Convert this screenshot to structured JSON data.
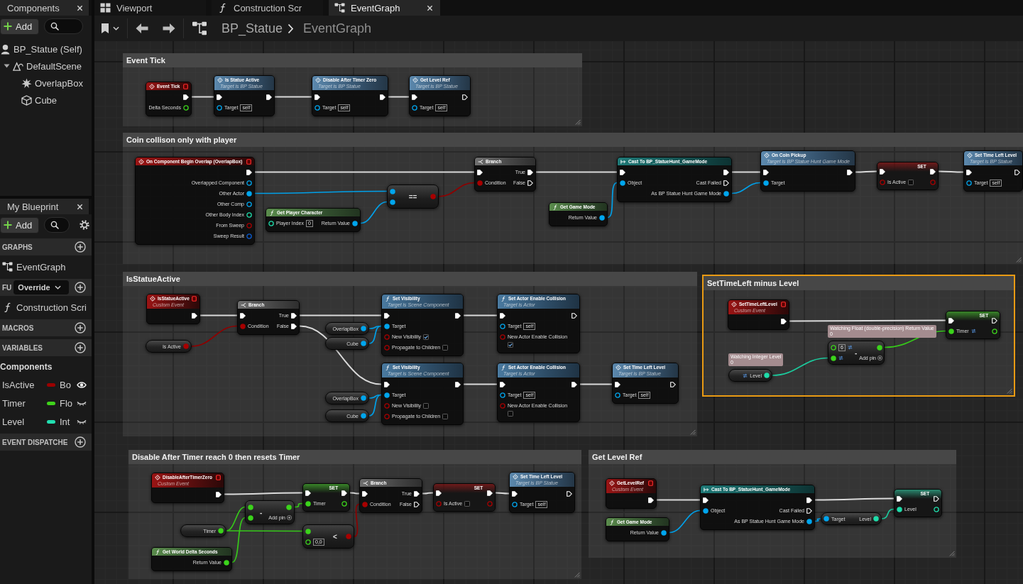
{
  "components_panel": {
    "tab": "Components",
    "add_button": "Add",
    "tree": [
      {
        "label": "BP_Statue (Self)",
        "kind": "actor"
      },
      {
        "label": "DefaultScene",
        "kind": "scene",
        "expanded": true,
        "children": [
          {
            "label": "OverlapBox",
            "kind": "collision"
          },
          {
            "label": "Cube",
            "kind": "mesh"
          }
        ]
      }
    ]
  },
  "my_blueprint_panel": {
    "tab": "My Blueprint",
    "add_button": "Add",
    "sections": [
      {
        "title": "GRAPHS",
        "items": [
          {
            "kind": "graph",
            "label": "EventGraph"
          }
        ]
      },
      {
        "title": "FU",
        "dropdown": "Override",
        "items": [
          {
            "kind": "function",
            "label": "Construction Scri"
          }
        ]
      },
      {
        "title": "MACROS"
      },
      {
        "title": "VARIABLES",
        "items": [
          {
            "kind": "category",
            "label": "Components"
          },
          {
            "kind": "variable",
            "label": "IsActive",
            "type_label": "Bo",
            "color": "#9b0000",
            "visible": true
          },
          {
            "kind": "variable",
            "label": "Timer",
            "type_label": "Flo",
            "color": "#3fd21b",
            "visible": false
          },
          {
            "kind": "variable",
            "label": "Level",
            "type_label": "Int",
            "color": "#22dfb0",
            "visible": false
          }
        ]
      },
      {
        "title": "EVENT DISPATCHE"
      }
    ]
  },
  "editor_tabs": [
    {
      "label": "Viewport",
      "kind": "viewport",
      "selected": false,
      "closable": false
    },
    {
      "label": "Construction Scr",
      "kind": "function",
      "selected": false,
      "closable": false
    },
    {
      "label": "EventGraph",
      "kind": "graph",
      "selected": true,
      "closable": true
    }
  ],
  "breadcrumb": [
    {
      "label": "BP_Statue"
    },
    {
      "label": "EventGraph"
    }
  ],
  "graph": {
    "comments": [
      {
        "title": "Event Tick",
        "selected": false,
        "nodes": [
          {
            "kind": "event",
            "title": "Event Tick",
            "outputs": [
              {
                "kind": "exec",
                "connected": true
              },
              {
                "kind": "float",
                "label": "Delta Seconds",
                "connected": false
              }
            ]
          },
          {
            "kind": "call",
            "title": "Is Statue Active",
            "subtitle": "Target is BP Statue",
            "inputs": [
              {
                "kind": "exec",
                "connected": true
              },
              {
                "kind": "object",
                "label": "Target",
                "value": "self",
                "connected": false
              }
            ],
            "outputs": [
              {
                "kind": "exec",
                "connected": true
              }
            ]
          },
          {
            "kind": "call",
            "title": "Disable After Timer Zero",
            "subtitle": "Target is BP Statue",
            "inputs": [
              {
                "kind": "exec",
                "connected": true
              },
              {
                "kind": "object",
                "label": "Target",
                "value": "self",
                "connected": false
              }
            ],
            "outputs": [
              {
                "kind": "exec",
                "connected": true
              }
            ]
          },
          {
            "kind": "call",
            "title": "Get Level Ref",
            "subtitle": "Target is BP Statue",
            "inputs": [
              {
                "kind": "exec",
                "connected": true
              },
              {
                "kind": "object",
                "label": "Target",
                "value": "self",
                "connected": false
              }
            ],
            "outputs": [
              {
                "kind": "exec",
                "connected": false
              }
            ]
          }
        ]
      },
      {
        "title": "Coin collison only with player",
        "selected": false,
        "nodes": [
          {
            "kind": "event",
            "title": "On Component Begin Overlap (OverlapBox)",
            "outputs": [
              {
                "kind": "exec",
                "connected": true
              },
              {
                "kind": "object",
                "label": "Overlapped Component",
                "connected": false
              },
              {
                "kind": "object",
                "label": "Other Actor",
                "connected": true
              },
              {
                "kind": "object",
                "label": "Other Comp",
                "connected": false
              },
              {
                "kind": "int",
                "label": "Other Body Index",
                "connected": false
              },
              {
                "kind": "bool",
                "label": "From Sweep",
                "connected": false
              },
              {
                "kind": "struct",
                "label": "Sweep Result",
                "connected": false
              }
            ]
          },
          {
            "kind": "pure",
            "title": "Get Player Character",
            "inputs": [
              {
                "kind": "int",
                "label": "Player Index",
                "value": "0",
                "connected": false
              }
            ],
            "outputs": [
              {
                "kind": "object",
                "label": "Return Value",
                "connected": true
              }
            ]
          },
          {
            "kind": "op",
            "title": "==",
            "inputs": [
              {
                "kind": "object",
                "connected": true
              },
              {
                "kind": "object",
                "connected": true
              }
            ],
            "outputs": [
              {
                "kind": "bool",
                "connected": true
              }
            ]
          },
          {
            "kind": "branch",
            "title": "Branch",
            "inputs": [
              {
                "kind": "exec",
                "connected": true
              },
              {
                "kind": "bool",
                "label": "Condition",
                "connected": true
              }
            ],
            "outputs": [
              {
                "kind": "exec",
                "label": "True",
                "connected": true
              },
              {
                "kind": "exec",
                "label": "False",
                "connected": false
              }
            ]
          },
          {
            "kind": "pure",
            "title": "Get Game Mode",
            "outputs": [
              {
                "kind": "object",
                "label": "Return Value",
                "connected": true
              }
            ]
          },
          {
            "kind": "cast",
            "title": "Cast To BP_StatueHunt_GameMode",
            "inputs": [
              {
                "kind": "exec",
                "connected": true
              },
              {
                "kind": "object",
                "label": "Object",
                "connected": true
              }
            ],
            "outputs": [
              {
                "kind": "exec",
                "connected": true
              },
              {
                "kind": "exec",
                "label": "Cast Failed",
                "connected": false
              },
              {
                "kind": "object",
                "label": "As BP Statue Hunt Game Mode",
                "connected": true
              }
            ]
          },
          {
            "kind": "call",
            "title": "On Coin Pickup",
            "subtitle": "Target is BP Statue Hunt Game Mode",
            "inputs": [
              {
                "kind": "exec",
                "connected": true
              },
              {
                "kind": "object",
                "label": "Target",
                "connected": true
              }
            ],
            "outputs": [
              {
                "kind": "exec",
                "connected": true
              }
            ]
          },
          {
            "kind": "set",
            "title": "SET",
            "inputs": [
              {
                "kind": "exec",
                "connected": true
              },
              {
                "kind": "bool",
                "label": "Is Active",
                "checked": false,
                "connected": false
              }
            ],
            "outputs": [
              {
                "kind": "exec",
                "connected": true
              },
              {
                "kind": "bool",
                "connected": false
              }
            ]
          },
          {
            "kind": "call",
            "title": "Set Time Left Level",
            "subtitle": "Target is BP Statue",
            "inputs": [
              {
                "kind": "exec",
                "connected": true
              },
              {
                "kind": "object",
                "label": "Target",
                "value": "self",
                "connected": false
              }
            ],
            "outputs": [
              {
                "kind": "exec",
                "connected": false
              }
            ]
          }
        ]
      },
      {
        "title": "IsStatueActive",
        "selected": false,
        "nodes": [
          {
            "kind": "event",
            "title": "IsStatueActive",
            "subtitle": "Custom Event",
            "outputs": [
              {
                "kind": "exec",
                "connected": true
              }
            ]
          },
          {
            "kind": "branch",
            "title": "Branch",
            "inputs": [
              {
                "kind": "exec",
                "connected": true
              },
              {
                "kind": "bool",
                "label": "Condition",
                "connected": true
              }
            ],
            "outputs": [
              {
                "kind": "exec",
                "label": "True",
                "connected": true
              },
              {
                "kind": "exec",
                "label": "False",
                "connected": true
              }
            ]
          },
          {
            "kind": "get",
            "outputs": [
              {
                "kind": "bool",
                "label": "Is Active",
                "connected": true
              }
            ]
          },
          {
            "kind": "function",
            "title": "Set Visibility",
            "subtitle": "Target is Scene Component",
            "inputs": [
              {
                "kind": "exec",
                "connected": true
              },
              {
                "kind": "object",
                "label": "Target",
                "connected": true
              },
              {
                "kind": "bool",
                "label": "New Visibility",
                "checked": true,
                "connected": false
              },
              {
                "kind": "bool",
                "label": "Propagate to Children",
                "checked": false,
                "connected": false
              }
            ],
            "outputs": [
              {
                "kind": "exec",
                "connected": true
              }
            ]
          },
          {
            "kind": "get",
            "outputs": [
              {
                "kind": "object",
                "label": "OverlapBox",
                "connected": true
              }
            ]
          },
          {
            "kind": "get",
            "outputs": [
              {
                "kind": "object",
                "label": "Cube",
                "connected": true
              }
            ]
          },
          {
            "kind": "function",
            "title": "Set Actor Enable Collision",
            "subtitle": "Target is Actor",
            "inputs": [
              {
                "kind": "exec",
                "connected": true
              },
              {
                "kind": "object",
                "label": "Target",
                "value": "self",
                "connected": false
              },
              {
                "kind": "bool",
                "label": "New Actor Enable Collision",
                "checked": true,
                "connected": false
              }
            ],
            "outputs": [
              {
                "kind": "exec",
                "connected": false
              }
            ]
          },
          {
            "kind": "function",
            "title": "Set Visibility",
            "subtitle": "Target is Scene Component",
            "inputs": [
              {
                "kind": "exec",
                "connected": true
              },
              {
                "kind": "object",
                "label": "Target",
                "connected": true
              },
              {
                "kind": "bool",
                "label": "New Visibility",
                "checked": false,
                "connected": false
              },
              {
                "kind": "bool",
                "label": "Propagate to Children",
                "checked": false,
                "connected": false
              }
            ],
            "outputs": [
              {
                "kind": "exec",
                "connected": true
              }
            ]
          },
          {
            "kind": "get",
            "outputs": [
              {
                "kind": "object",
                "label": "OverlapBox",
                "connected": true
              }
            ]
          },
          {
            "kind": "get",
            "outputs": [
              {
                "kind": "object",
                "label": "Cube",
                "connected": true
              }
            ]
          },
          {
            "kind": "function",
            "title": "Set Actor Enable Collision",
            "subtitle": "Target is Actor",
            "inputs": [
              {
                "kind": "exec",
                "connected": true
              },
              {
                "kind": "object",
                "label": "Target",
                "value": "self",
                "connected": false
              },
              {
                "kind": "bool",
                "label": "New Actor Enable Collision",
                "checked": false,
                "connected": false
              }
            ],
            "outputs": [
              {
                "kind": "exec",
                "connected": true
              }
            ]
          },
          {
            "kind": "call",
            "title": "Set Time Left Level",
            "subtitle": "Target is BP Statue",
            "inputs": [
              {
                "kind": "exec",
                "connected": true
              },
              {
                "kind": "object",
                "label": "Target",
                "value": "self",
                "connected": false
              }
            ],
            "outputs": [
              {
                "kind": "exec",
                "connected": false
              }
            ]
          }
        ]
      },
      {
        "title": "SetTimeLeft minus Level",
        "selected": true,
        "nodes": [
          {
            "kind": "event",
            "title": "SetTimeLeftLevel",
            "subtitle": "Custom Event",
            "outputs": [
              {
                "kind": "exec",
                "connected": true
              }
            ]
          },
          {
            "kind": "set",
            "title": "SET",
            "inputs": [
              {
                "kind": "exec",
                "connected": true
              },
              {
                "kind": "float",
                "label": "Timer",
                "converted": true,
                "connected": true
              }
            ],
            "outputs": [
              {
                "kind": "exec",
                "connected": false
              },
              {
                "kind": "float",
                "connected": false
              }
            ]
          },
          {
            "kind": "op",
            "title": "-",
            "add_pin": "Add pin",
            "inputs": [
              {
                "kind": "float",
                "value": "6",
                "converted": true,
                "connected": false
              },
              {
                "kind": "float",
                "converted": true,
                "connected": true
              }
            ],
            "outputs": [
              {
                "kind": "float",
                "connected": true,
                "watch": {
                  "label": "Watching Float (double-precision) Return Value",
                  "value": "0"
                }
              }
            ]
          },
          {
            "kind": "get",
            "outputs": [
              {
                "kind": "int",
                "label": "Level",
                "converted": true,
                "connected": true,
                "watch": {
                  "label": "Watching Integer Level",
                  "value": "0"
                }
              }
            ]
          }
        ]
      },
      {
        "title": "Disable After Timer reach 0 then resets Timer",
        "selected": false,
        "nodes": [
          {
            "kind": "event",
            "title": "DisableAfterTimerZero",
            "subtitle": "Custom Event",
            "outputs": [
              {
                "kind": "exec",
                "connected": true
              }
            ]
          },
          {
            "kind": "set",
            "title": "SET",
            "inputs": [
              {
                "kind": "exec",
                "connected": true
              },
              {
                "kind": "float",
                "label": "Timer",
                "connected": true
              }
            ],
            "outputs": [
              {
                "kind": "exec",
                "connected": true
              },
              {
                "kind": "float",
                "connected": false
              }
            ]
          },
          {
            "kind": "op",
            "title": "-",
            "add_pin": "Add pin",
            "inputs": [
              {
                "kind": "float",
                "connected": true
              },
              {
                "kind": "float",
                "connected": true
              }
            ],
            "outputs": [
              {
                "kind": "float",
                "connected": true
              }
            ]
          },
          {
            "kind": "get",
            "outputs": [
              {
                "kind": "float",
                "label": "Timer",
                "connected": true
              }
            ]
          },
          {
            "kind": "pure",
            "title": "Get World Delta Seconds",
            "outputs": [
              {
                "kind": "float",
                "label": "Return Value",
                "connected": true
              }
            ]
          },
          {
            "kind": "op",
            "title": "<",
            "inputs": [
              {
                "kind": "float",
                "connected": true
              },
              {
                "kind": "float",
                "value": "0,0",
                "connected": false
              }
            ],
            "outputs": [
              {
                "kind": "bool",
                "connected": true
              }
            ]
          },
          {
            "kind": "branch",
            "title": "Branch",
            "inputs": [
              {
                "kind": "exec",
                "connected": true
              },
              {
                "kind": "bool",
                "label": "Condition",
                "connected": true
              }
            ],
            "outputs": [
              {
                "kind": "exec",
                "label": "True",
                "connected": true
              },
              {
                "kind": "exec",
                "label": "False",
                "connected": false
              }
            ]
          },
          {
            "kind": "set",
            "title": "SET",
            "inputs": [
              {
                "kind": "exec",
                "connected": true
              },
              {
                "kind": "bool",
                "label": "Is Active",
                "checked": false,
                "connected": false
              }
            ],
            "outputs": [
              {
                "kind": "exec",
                "connected": true
              },
              {
                "kind": "bool",
                "connected": false
              }
            ]
          },
          {
            "kind": "call",
            "title": "Set Time Left Level",
            "subtitle": "Target is BP Statue",
            "inputs": [
              {
                "kind": "exec",
                "connected": true
              },
              {
                "kind": "object",
                "label": "Target",
                "value": "self",
                "connected": false
              }
            ],
            "outputs": [
              {
                "kind": "exec",
                "connected": false
              }
            ]
          }
        ]
      },
      {
        "title": "Get Level Ref",
        "selected": false,
        "nodes": [
          {
            "kind": "event",
            "title": "GetLevelRef",
            "subtitle": "Custom Event",
            "outputs": [
              {
                "kind": "exec",
                "connected": true
              }
            ]
          },
          {
            "kind": "pure",
            "title": "Get Game Mode",
            "outputs": [
              {
                "kind": "object",
                "label": "Return Value",
                "connected": true
              }
            ]
          },
          {
            "kind": "cast",
            "title": "Cast To BP_StatueHunt_GameMode",
            "inputs": [
              {
                "kind": "exec",
                "connected": true
              },
              {
                "kind": "object",
                "label": "Object",
                "connected": true
              }
            ],
            "outputs": [
              {
                "kind": "exec",
                "connected": true
              },
              {
                "kind": "exec",
                "label": "Cast Failed",
                "connected": false
              },
              {
                "kind": "object",
                "label": "As BP Statue Hunt Game Mode",
                "connected": true
              }
            ]
          },
          {
            "kind": "get",
            "inputs": [
              {
                "kind": "object",
                "label": "Target",
                "connected": true
              }
            ],
            "outputs": [
              {
                "kind": "int",
                "label": "Level",
                "connected": true
              }
            ]
          },
          {
            "kind": "set",
            "title": "SET",
            "inputs": [
              {
                "kind": "exec",
                "connected": true
              },
              {
                "kind": "int",
                "label": "Level",
                "connected": true
              }
            ],
            "outputs": [
              {
                "kind": "exec",
                "connected": false
              },
              {
                "kind": "int",
                "connected": false
              }
            ]
          }
        ]
      }
    ]
  }
}
